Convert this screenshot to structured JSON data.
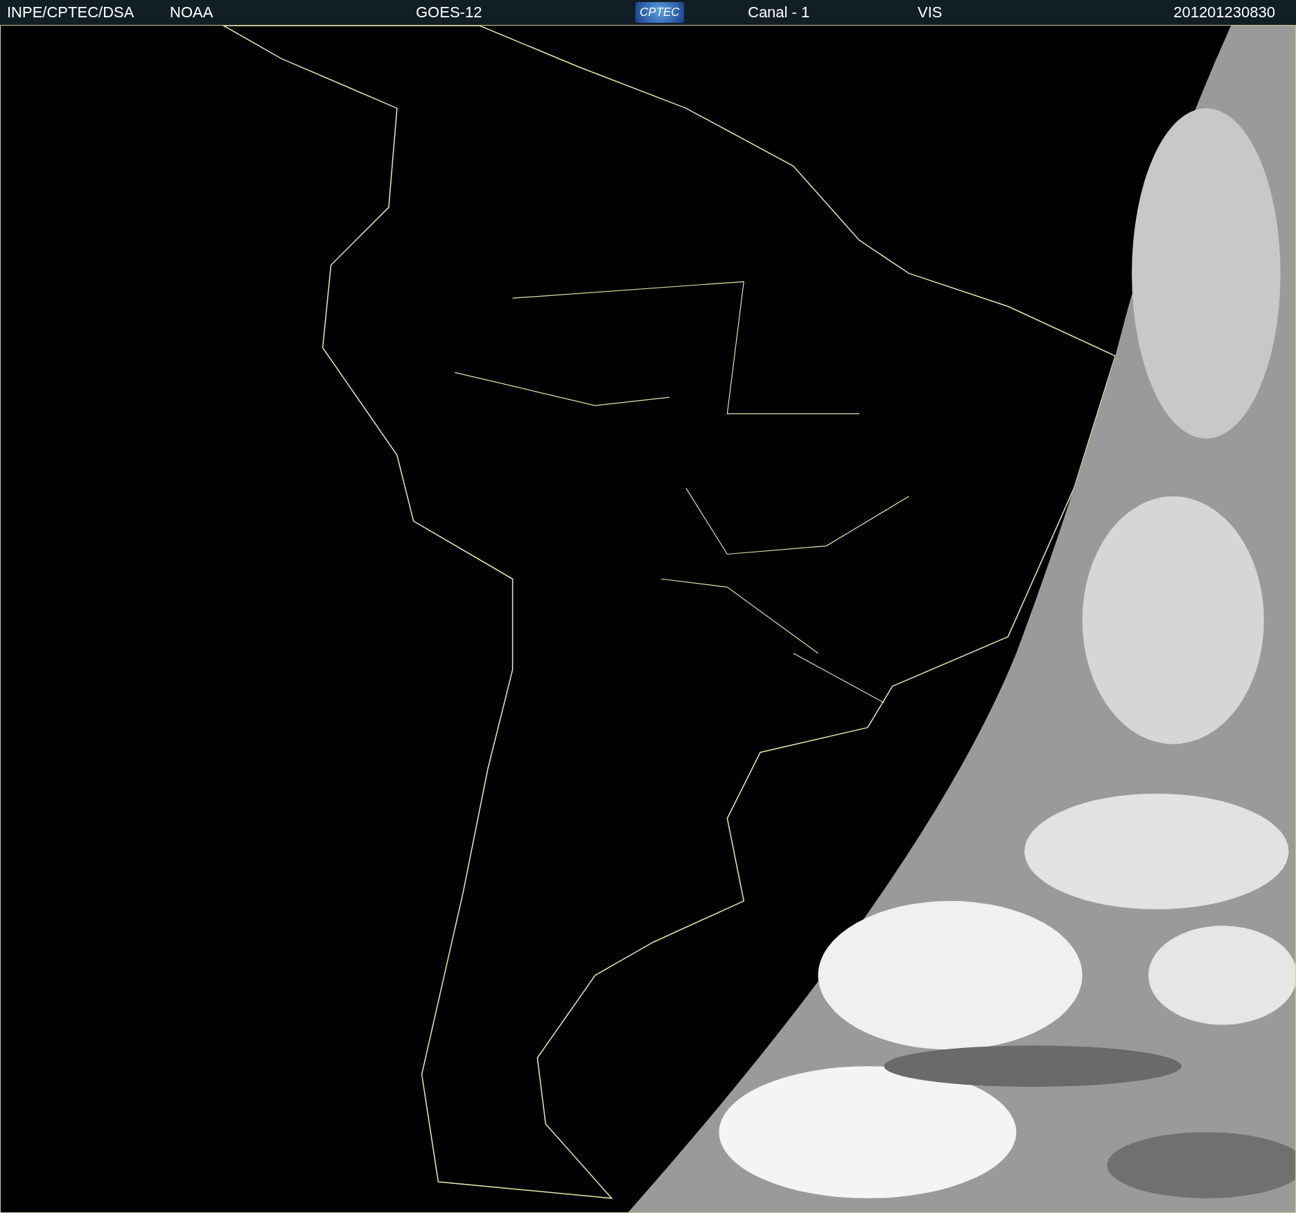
{
  "header": {
    "items": [
      {
        "kind": "text",
        "text": "INPE/CPTEC/DSA"
      },
      {
        "kind": "text",
        "text": "NOAA"
      },
      {
        "kind": "text",
        "text": "GOES-12"
      },
      {
        "kind": "logo",
        "text": "CPTEC"
      },
      {
        "kind": "text",
        "text": "Canal - 1"
      },
      {
        "kind": "text",
        "text": "VIS"
      },
      {
        "kind": "text",
        "text": "201201230830"
      }
    ]
  }
}
